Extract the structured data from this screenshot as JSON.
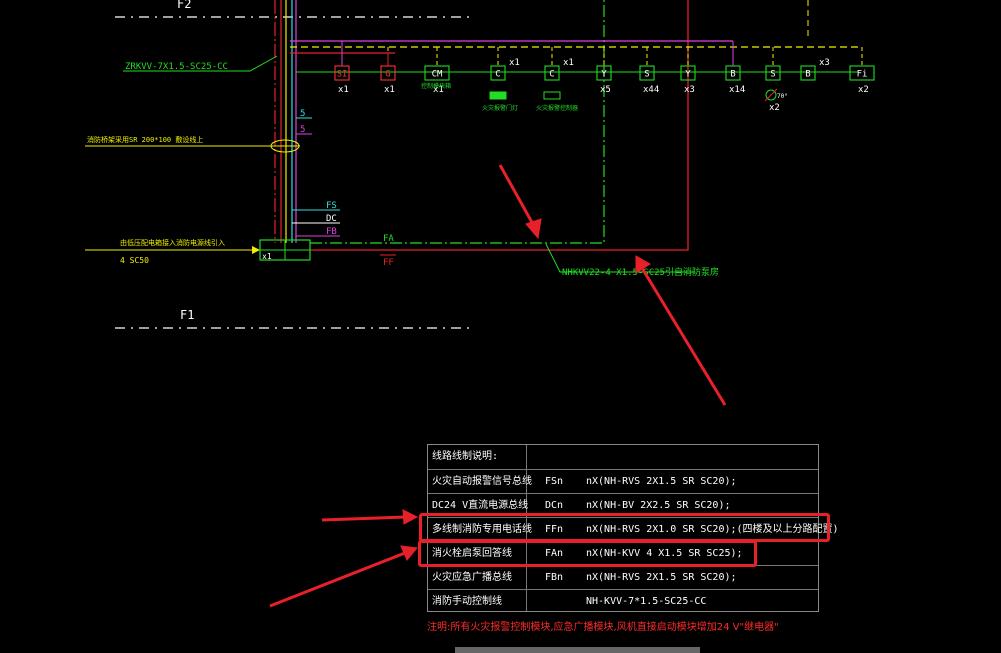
{
  "floors": {
    "upper": "F2",
    "lower": "F1"
  },
  "cables": {
    "zrkvv": "ZRKVV-7X1.5-SC25-CC",
    "nhkvv": "NHKVV22-4 X1.5-SC25引自消防泵房",
    "bridge": "消防桥架采用SR 200*100 敷设线上",
    "incoming": "由低压配电箱接入消防电源线引入",
    "incoming_spec": "4 SC50",
    "five_a": "5",
    "five_b": "5"
  },
  "bus_labels": {
    "fs": "FS",
    "dc": "DC",
    "fb": "FB",
    "fa": "FA",
    "ff": "FF",
    "box_x": "x1"
  },
  "devices": [
    {
      "sym": "SI",
      "count": "x1",
      "sub": "",
      "color": "#ff3030"
    },
    {
      "sym": "G",
      "count": "x1",
      "sub": "",
      "color": "#ff3030"
    },
    {
      "sym": "CM",
      "count": "x1",
      "sub": "控制模块箱",
      "color": "#ffffff"
    },
    {
      "sym": "C",
      "count": "x1",
      "sub": "火灾报警门灯",
      "color": "#ffffff"
    },
    {
      "sym": "C",
      "count": "x1",
      "sub": "火灾报警控制器",
      "color": "#ffffff"
    },
    {
      "sym": "Y",
      "count": "x5",
      "sub": "",
      "color": "#ffffff"
    },
    {
      "sym": "S",
      "count": "x44",
      "sub": "",
      "color": "#ffffff"
    },
    {
      "sym": "Y",
      "count": "x3",
      "sub": "",
      "color": "#ffffff"
    },
    {
      "sym": "B",
      "count": "x14",
      "sub": "",
      "color": "#ffffff"
    },
    {
      "sym": "S",
      "count": "x2",
      "sub": "70°",
      "color": "#ffffff"
    },
    {
      "sym": "B",
      "count": "x3",
      "sub": "",
      "color": "#ffffff"
    },
    {
      "sym": "Fi",
      "count": "x2",
      "sub": "",
      "color": "#ffffff"
    }
  ],
  "legend": {
    "header": "线路线制说明:",
    "rows": [
      {
        "name": "火灾自动报警信号总线",
        "code": "FSn",
        "spec": "nX(NH-RVS 2X1.5  SR  SC20);"
      },
      {
        "name": "DC24 V直流电源总线",
        "code": "DCn",
        "spec": "nX(NH-BV 2X2.5  SR  SC20);"
      },
      {
        "name": "多线制消防专用电话线",
        "code": "FFn",
        "spec": "nX(NH-RVS 2X1.0  SR  SC20);(四楼及以上分路配置)"
      },
      {
        "name": "消火栓启泵回答线",
        "code": "FAn",
        "spec": "nX(NH-KVV 4 X1.5  SR  SC25);"
      },
      {
        "name": "火灾应急广播总线",
        "code": "FBn",
        "spec": "nX(NH-RVS 2X1.5  SR  SC20);"
      },
      {
        "name": "消防手动控制线",
        "code": "",
        "spec": "NH-KVV-7*1.5-SC25-CC"
      }
    ],
    "note": "注明:所有火灾报警控制模块,应急广播模块,风机直接启动模块增加24 V\"继电器\""
  },
  "colors": {
    "red": "#e8202a",
    "green": "#22dd22",
    "cyan": "#30e0e0",
    "magenta": "#e040e0",
    "yellow": "#f0f000"
  }
}
